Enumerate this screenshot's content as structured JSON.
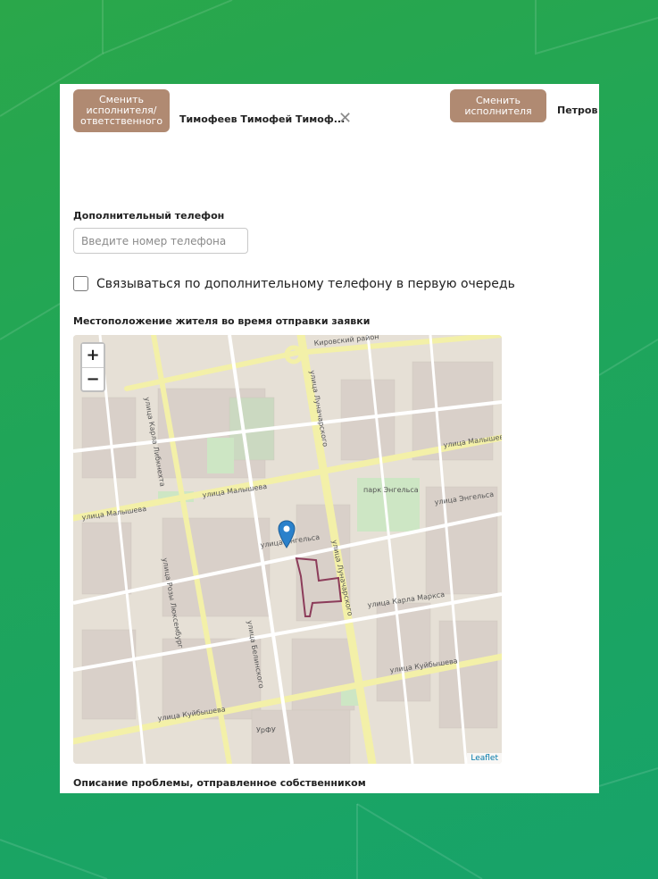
{
  "header": {
    "change_executor_responsible_label": "Сменить исполнителя/ ответственного",
    "executor_name": "Тимофеев Тимофей Тимоф...",
    "change_executor_label": "Сменить исполнителя",
    "second_executor_name": "Петров"
  },
  "icons": {
    "clear": "close-icon"
  },
  "phone": {
    "label": "Дополнительный телефон",
    "placeholder": "Введите номер телефона",
    "value": ""
  },
  "priority_contact": {
    "label": "Связываться по дополнительному телефону в первую очередь",
    "checked": false
  },
  "location": {
    "label": "Местоположение жителя во время отправки заявки",
    "zoom_in": "+",
    "zoom_out": "−",
    "attribution": "Leaflet",
    "streets": {
      "malysheva": "улица Малышева",
      "malysheva2": "улица Малышева",
      "malysheva3": "улица Малышева",
      "kuybysheva": "улица Куйбышева",
      "kuybysheva2": "улица Куйбышева",
      "lunacharskogo": "улица Луначарского",
      "lunacharskogo2": "улица Луначарского",
      "belinskogo": "улица Белинского",
      "rozy": "улица Розы Люксембург",
      "karla_libknehta": "улица Карла Либкнехта",
      "engelsa": "улица Энгельса",
      "engelsa2": "улица Энгельса",
      "karla_marksa": "улица Карла Маркса",
      "kirovskiy": "Кировский район",
      "park": "парк Энгельса",
      "urfu": "УрФУ"
    }
  },
  "description": {
    "label": "Описание проблемы, отправленное собственником"
  },
  "colors": {
    "accent_brown": "#b08a72",
    "background_green": "#1fa55a",
    "marker_blue": "#2a81cb"
  }
}
